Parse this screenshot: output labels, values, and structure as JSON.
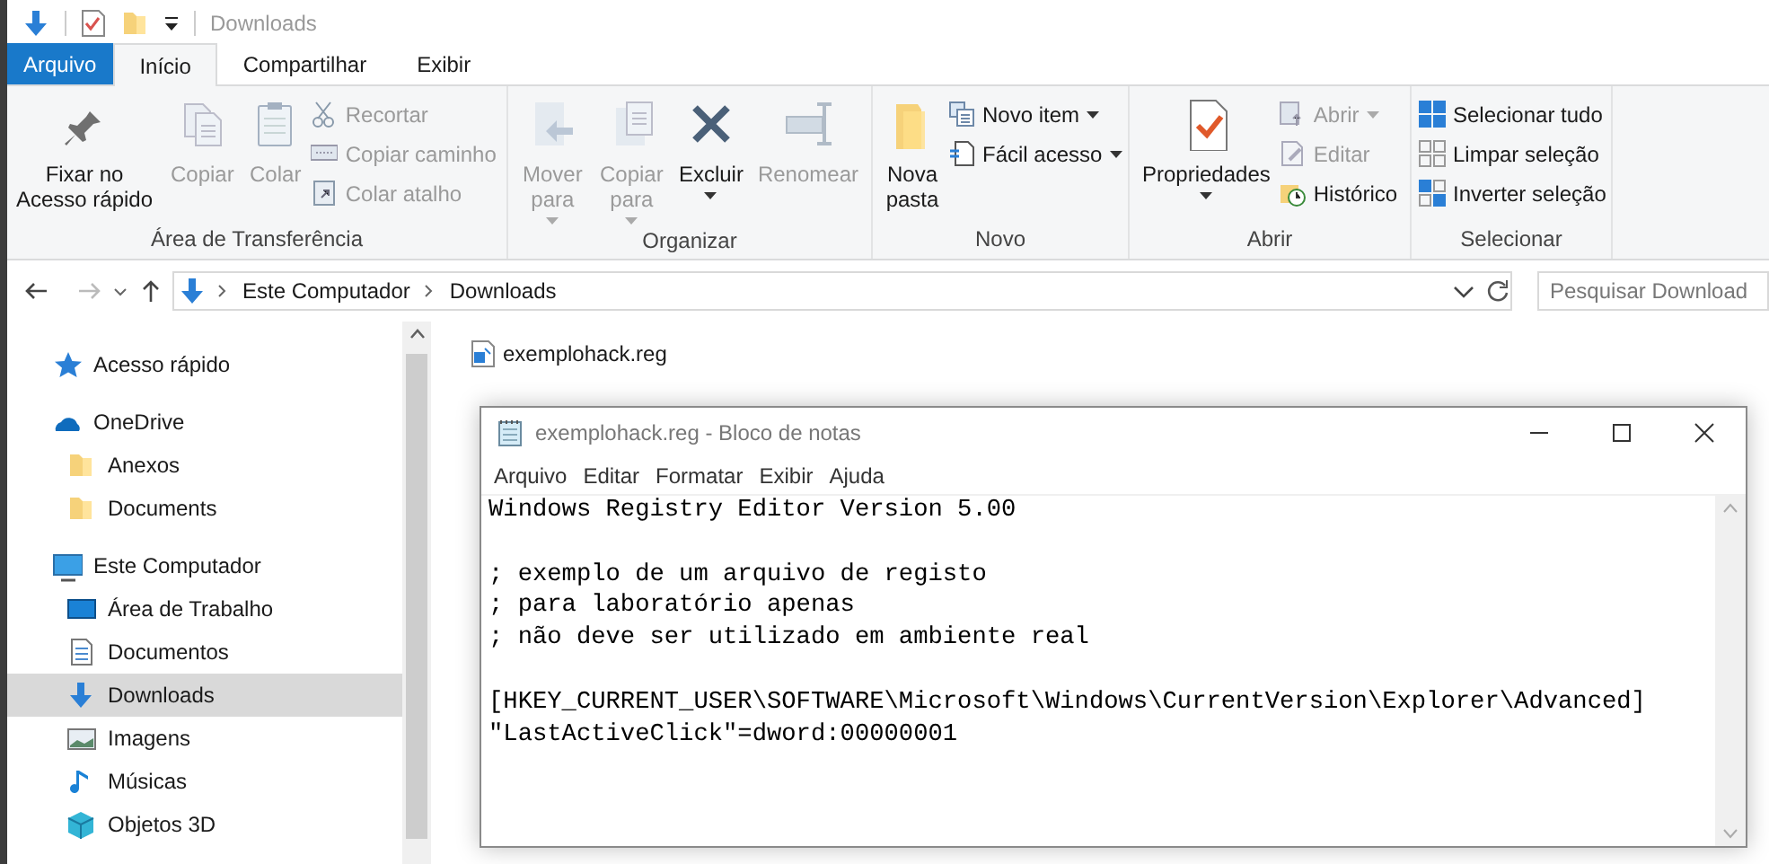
{
  "quick_access": {
    "title": "Downloads"
  },
  "tabs": [
    {
      "label": "Arquivo",
      "kind": "file",
      "selected": false
    },
    {
      "label": "Início",
      "kind": "tab",
      "selected": true
    },
    {
      "label": "Compartilhar",
      "kind": "tab",
      "selected": false
    },
    {
      "label": "Exibir",
      "kind": "tab",
      "selected": false
    }
  ],
  "ribbon": [
    {
      "title": "Área de Transferência",
      "items": [
        {
          "label": "Fixar no Acesso rápido",
          "kind": "large",
          "disabled": false
        },
        {
          "label": "Copiar",
          "kind": "large",
          "disabled": true
        },
        {
          "label": "Colar",
          "kind": "large",
          "disabled": true
        },
        {
          "kind": "stack",
          "items": [
            {
              "label": "Recortar",
              "disabled": true,
              "dropdown": false
            },
            {
              "label": "Copiar caminho",
              "disabled": true,
              "dropdown": false
            },
            {
              "label": "Colar atalho",
              "disabled": true,
              "dropdown": false
            }
          ]
        }
      ]
    },
    {
      "title": "Organizar",
      "items": [
        {
          "label": "Mover para",
          "kind": "large",
          "disabled": true,
          "dropdown": true
        },
        {
          "label": "Copiar para",
          "kind": "large",
          "disabled": true,
          "dropdown": true
        },
        {
          "label": "Excluir",
          "kind": "large",
          "disabled": false,
          "dropdown": true
        },
        {
          "label": "Renomear",
          "kind": "large",
          "disabled": true
        }
      ]
    },
    {
      "title": "Novo",
      "items": [
        {
          "label": "Nova pasta",
          "kind": "large",
          "disabled": false
        },
        {
          "kind": "stack",
          "items": [
            {
              "label": "Novo item",
              "disabled": false,
              "dropdown": true
            },
            {
              "label": "Fácil acesso",
              "disabled": false,
              "dropdown": true
            }
          ]
        }
      ]
    },
    {
      "title": "Abrir",
      "items": [
        {
          "label": "Propriedades",
          "kind": "large",
          "disabled": false,
          "dropdown": true
        },
        {
          "kind": "stack",
          "items": [
            {
              "label": "Abrir",
              "disabled": true,
              "dropdown": true
            },
            {
              "label": "Editar",
              "disabled": true,
              "dropdown": false
            },
            {
              "label": "Histórico",
              "disabled": false,
              "dropdown": false
            }
          ]
        }
      ]
    },
    {
      "title": "Selecionar",
      "items": [
        {
          "kind": "stack",
          "items": [
            {
              "label": "Selecionar tudo",
              "disabled": false,
              "dropdown": false
            },
            {
              "label": "Limpar seleção",
              "disabled": false,
              "dropdown": false
            },
            {
              "label": "Inverter seleção",
              "disabled": false,
              "dropdown": false
            }
          ]
        }
      ]
    }
  ],
  "address_bar": {
    "path": [
      "Este Computador",
      "Downloads"
    ],
    "search_placeholder": "Pesquisar Download"
  },
  "navigation": [
    {
      "label": "Acesso rápido",
      "selected": false
    },
    {
      "label": "OneDrive",
      "selected": false,
      "children": [
        {
          "label": "Anexos",
          "selected": false
        },
        {
          "label": "Documents",
          "selected": false
        }
      ]
    },
    {
      "label": "Este Computador",
      "selected": false,
      "children": [
        {
          "label": "Área de Trabalho",
          "selected": false
        },
        {
          "label": "Documentos",
          "selected": false
        },
        {
          "label": "Downloads",
          "selected": true
        },
        {
          "label": "Imagens",
          "selected": false
        },
        {
          "label": "Músicas",
          "selected": false
        },
        {
          "label": "Objetos 3D",
          "selected": false
        }
      ]
    }
  ],
  "files": [
    {
      "name": "exemplohack.reg"
    }
  ],
  "notepad": {
    "title": "exemplohack.reg - Bloco de notas",
    "menu": [
      "Arquivo",
      "Editar",
      "Formatar",
      "Exibir",
      "Ajuda"
    ],
    "text": "Windows Registry Editor Version 5.00\n\n; exemplo de um arquivo de registo\n; para laboratório apenas\n; não deve ser utilizado em ambiente real\n\n[HKEY_CURRENT_USER\\SOFTWARE\\Microsoft\\Windows\\CurrentVersion\\Explorer\\Advanced]\n\"LastActiveClick\"=dword:00000001"
  }
}
